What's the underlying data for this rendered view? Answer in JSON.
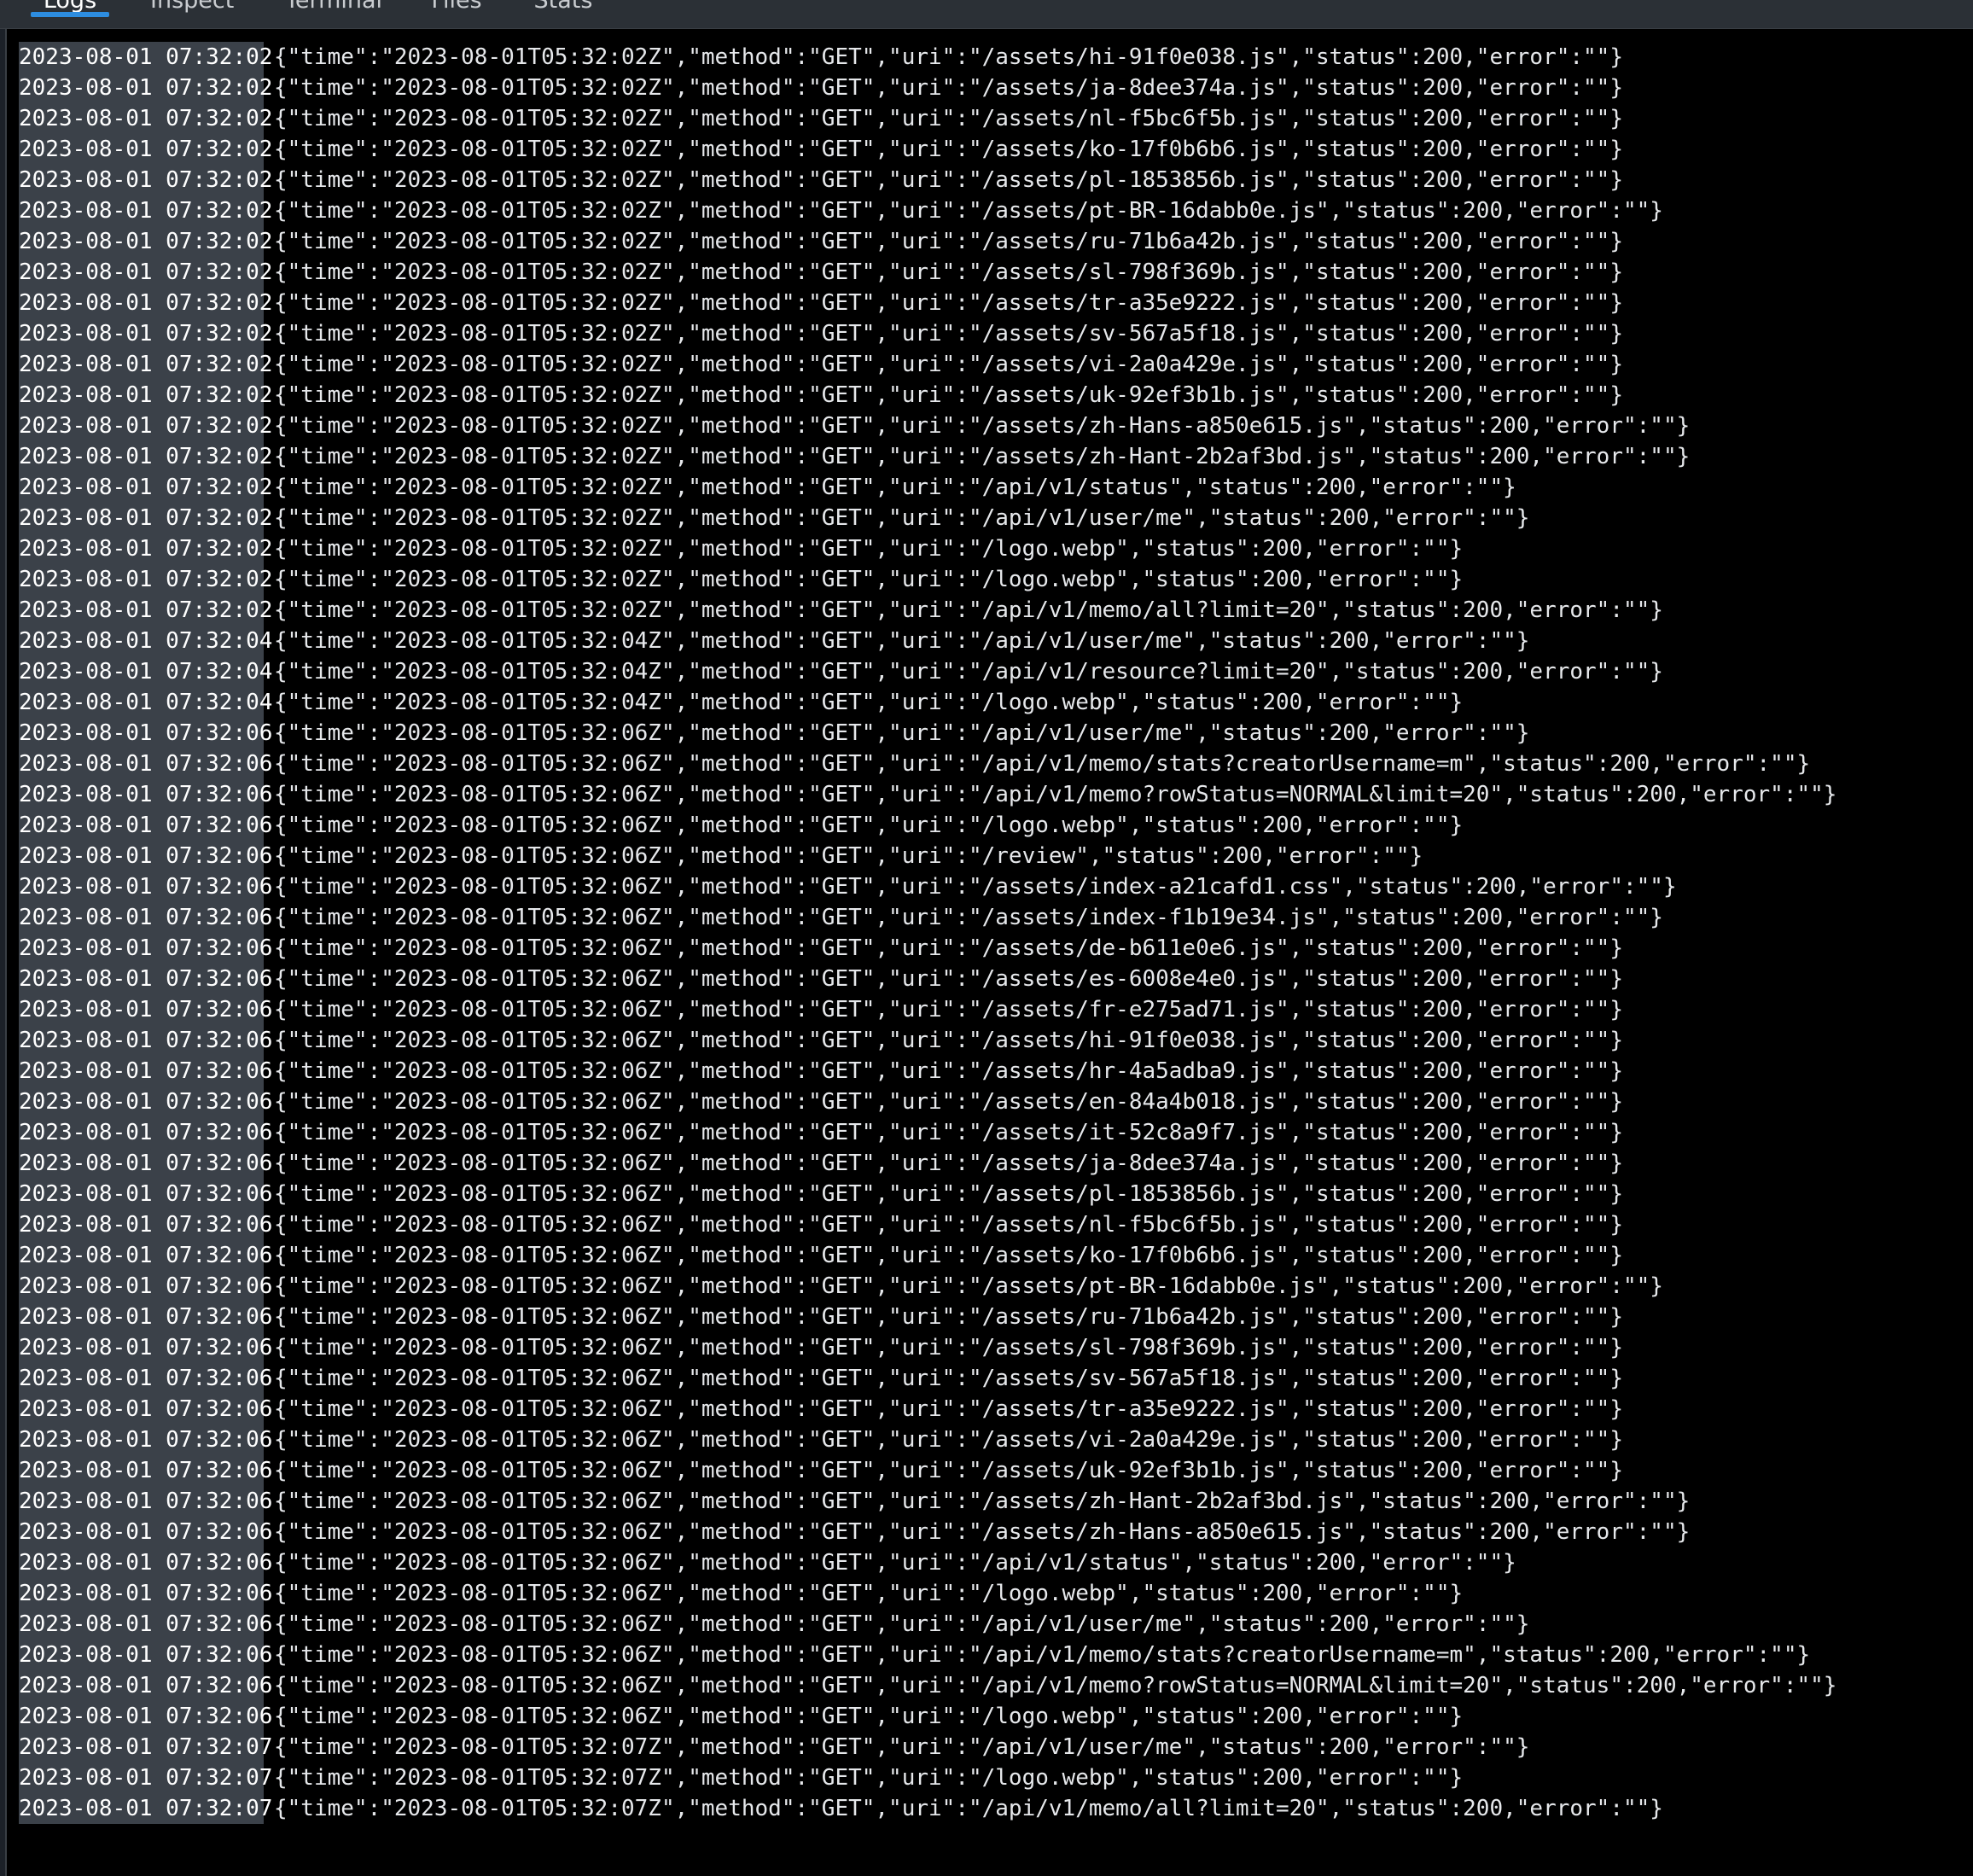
{
  "tabs": [
    {
      "label": "Logs",
      "active": true
    },
    {
      "label": "Inspect",
      "active": false
    },
    {
      "label": "Terminal",
      "active": false
    },
    {
      "label": "Files",
      "active": false
    },
    {
      "label": "Stats",
      "active": false
    }
  ],
  "colors": {
    "accent": "#2d8de0",
    "console_bg": "#000000",
    "timestamp_bg": "#3b4149"
  },
  "logs": [
    {
      "ts": "2023-08-01 07:32:02",
      "msg": "{\"time\":\"2023-08-01T05:32:02Z\",\"method\":\"GET\",\"uri\":\"/assets/hi-91f0e038.js\",\"status\":200,\"error\":\"\"}"
    },
    {
      "ts": "2023-08-01 07:32:02",
      "msg": "{\"time\":\"2023-08-01T05:32:02Z\",\"method\":\"GET\",\"uri\":\"/assets/ja-8dee374a.js\",\"status\":200,\"error\":\"\"}"
    },
    {
      "ts": "2023-08-01 07:32:02",
      "msg": "{\"time\":\"2023-08-01T05:32:02Z\",\"method\":\"GET\",\"uri\":\"/assets/nl-f5bc6f5b.js\",\"status\":200,\"error\":\"\"}"
    },
    {
      "ts": "2023-08-01 07:32:02",
      "msg": "{\"time\":\"2023-08-01T05:32:02Z\",\"method\":\"GET\",\"uri\":\"/assets/ko-17f0b6b6.js\",\"status\":200,\"error\":\"\"}"
    },
    {
      "ts": "2023-08-01 07:32:02",
      "msg": "{\"time\":\"2023-08-01T05:32:02Z\",\"method\":\"GET\",\"uri\":\"/assets/pl-1853856b.js\",\"status\":200,\"error\":\"\"}"
    },
    {
      "ts": "2023-08-01 07:32:02",
      "msg": "{\"time\":\"2023-08-01T05:32:02Z\",\"method\":\"GET\",\"uri\":\"/assets/pt-BR-16dabb0e.js\",\"status\":200,\"error\":\"\"}"
    },
    {
      "ts": "2023-08-01 07:32:02",
      "msg": "{\"time\":\"2023-08-01T05:32:02Z\",\"method\":\"GET\",\"uri\":\"/assets/ru-71b6a42b.js\",\"status\":200,\"error\":\"\"}"
    },
    {
      "ts": "2023-08-01 07:32:02",
      "msg": "{\"time\":\"2023-08-01T05:32:02Z\",\"method\":\"GET\",\"uri\":\"/assets/sl-798f369b.js\",\"status\":200,\"error\":\"\"}"
    },
    {
      "ts": "2023-08-01 07:32:02",
      "msg": "{\"time\":\"2023-08-01T05:32:02Z\",\"method\":\"GET\",\"uri\":\"/assets/tr-a35e9222.js\",\"status\":200,\"error\":\"\"}"
    },
    {
      "ts": "2023-08-01 07:32:02",
      "msg": "{\"time\":\"2023-08-01T05:32:02Z\",\"method\":\"GET\",\"uri\":\"/assets/sv-567a5f18.js\",\"status\":200,\"error\":\"\"}"
    },
    {
      "ts": "2023-08-01 07:32:02",
      "msg": "{\"time\":\"2023-08-01T05:32:02Z\",\"method\":\"GET\",\"uri\":\"/assets/vi-2a0a429e.js\",\"status\":200,\"error\":\"\"}"
    },
    {
      "ts": "2023-08-01 07:32:02",
      "msg": "{\"time\":\"2023-08-01T05:32:02Z\",\"method\":\"GET\",\"uri\":\"/assets/uk-92ef3b1b.js\",\"status\":200,\"error\":\"\"}"
    },
    {
      "ts": "2023-08-01 07:32:02",
      "msg": "{\"time\":\"2023-08-01T05:32:02Z\",\"method\":\"GET\",\"uri\":\"/assets/zh-Hans-a850e615.js\",\"status\":200,\"error\":\"\"}"
    },
    {
      "ts": "2023-08-01 07:32:02",
      "msg": "{\"time\":\"2023-08-01T05:32:02Z\",\"method\":\"GET\",\"uri\":\"/assets/zh-Hant-2b2af3bd.js\",\"status\":200,\"error\":\"\"}"
    },
    {
      "ts": "2023-08-01 07:32:02",
      "msg": "{\"time\":\"2023-08-01T05:32:02Z\",\"method\":\"GET\",\"uri\":\"/api/v1/status\",\"status\":200,\"error\":\"\"}"
    },
    {
      "ts": "2023-08-01 07:32:02",
      "msg": "{\"time\":\"2023-08-01T05:32:02Z\",\"method\":\"GET\",\"uri\":\"/api/v1/user/me\",\"status\":200,\"error\":\"\"}"
    },
    {
      "ts": "2023-08-01 07:32:02",
      "msg": "{\"time\":\"2023-08-01T05:32:02Z\",\"method\":\"GET\",\"uri\":\"/logo.webp\",\"status\":200,\"error\":\"\"}"
    },
    {
      "ts": "2023-08-01 07:32:02",
      "msg": "{\"time\":\"2023-08-01T05:32:02Z\",\"method\":\"GET\",\"uri\":\"/logo.webp\",\"status\":200,\"error\":\"\"}"
    },
    {
      "ts": "2023-08-01 07:32:02",
      "msg": "{\"time\":\"2023-08-01T05:32:02Z\",\"method\":\"GET\",\"uri\":\"/api/v1/memo/all?limit=20\",\"status\":200,\"error\":\"\"}"
    },
    {
      "ts": "2023-08-01 07:32:04",
      "msg": "{\"time\":\"2023-08-01T05:32:04Z\",\"method\":\"GET\",\"uri\":\"/api/v1/user/me\",\"status\":200,\"error\":\"\"}"
    },
    {
      "ts": "2023-08-01 07:32:04",
      "msg": "{\"time\":\"2023-08-01T05:32:04Z\",\"method\":\"GET\",\"uri\":\"/api/v1/resource?limit=20\",\"status\":200,\"error\":\"\"}"
    },
    {
      "ts": "2023-08-01 07:32:04",
      "msg": "{\"time\":\"2023-08-01T05:32:04Z\",\"method\":\"GET\",\"uri\":\"/logo.webp\",\"status\":200,\"error\":\"\"}"
    },
    {
      "ts": "2023-08-01 07:32:06",
      "msg": "{\"time\":\"2023-08-01T05:32:06Z\",\"method\":\"GET\",\"uri\":\"/api/v1/user/me\",\"status\":200,\"error\":\"\"}"
    },
    {
      "ts": "2023-08-01 07:32:06",
      "msg": "{\"time\":\"2023-08-01T05:32:06Z\",\"method\":\"GET\",\"uri\":\"/api/v1/memo/stats?creatorUsername=m\",\"status\":200,\"error\":\"\"}"
    },
    {
      "ts": "2023-08-01 07:32:06",
      "msg": "{\"time\":\"2023-08-01T05:32:06Z\",\"method\":\"GET\",\"uri\":\"/api/v1/memo?rowStatus=NORMAL&limit=20\",\"status\":200,\"error\":\"\"}"
    },
    {
      "ts": "2023-08-01 07:32:06",
      "msg": "{\"time\":\"2023-08-01T05:32:06Z\",\"method\":\"GET\",\"uri\":\"/logo.webp\",\"status\":200,\"error\":\"\"}"
    },
    {
      "ts": "2023-08-01 07:32:06",
      "msg": "{\"time\":\"2023-08-01T05:32:06Z\",\"method\":\"GET\",\"uri\":\"/review\",\"status\":200,\"error\":\"\"}"
    },
    {
      "ts": "2023-08-01 07:32:06",
      "msg": "{\"time\":\"2023-08-01T05:32:06Z\",\"method\":\"GET\",\"uri\":\"/assets/index-a21cafd1.css\",\"status\":200,\"error\":\"\"}"
    },
    {
      "ts": "2023-08-01 07:32:06",
      "msg": "{\"time\":\"2023-08-01T05:32:06Z\",\"method\":\"GET\",\"uri\":\"/assets/index-f1b19e34.js\",\"status\":200,\"error\":\"\"}"
    },
    {
      "ts": "2023-08-01 07:32:06",
      "msg": "{\"time\":\"2023-08-01T05:32:06Z\",\"method\":\"GET\",\"uri\":\"/assets/de-b611e0e6.js\",\"status\":200,\"error\":\"\"}"
    },
    {
      "ts": "2023-08-01 07:32:06",
      "msg": "{\"time\":\"2023-08-01T05:32:06Z\",\"method\":\"GET\",\"uri\":\"/assets/es-6008e4e0.js\",\"status\":200,\"error\":\"\"}"
    },
    {
      "ts": "2023-08-01 07:32:06",
      "msg": "{\"time\":\"2023-08-01T05:32:06Z\",\"method\":\"GET\",\"uri\":\"/assets/fr-e275ad71.js\",\"status\":200,\"error\":\"\"}"
    },
    {
      "ts": "2023-08-01 07:32:06",
      "msg": "{\"time\":\"2023-08-01T05:32:06Z\",\"method\":\"GET\",\"uri\":\"/assets/hi-91f0e038.js\",\"status\":200,\"error\":\"\"}"
    },
    {
      "ts": "2023-08-01 07:32:06",
      "msg": "{\"time\":\"2023-08-01T05:32:06Z\",\"method\":\"GET\",\"uri\":\"/assets/hr-4a5adba9.js\",\"status\":200,\"error\":\"\"}"
    },
    {
      "ts": "2023-08-01 07:32:06",
      "msg": "{\"time\":\"2023-08-01T05:32:06Z\",\"method\":\"GET\",\"uri\":\"/assets/en-84a4b018.js\",\"status\":200,\"error\":\"\"}"
    },
    {
      "ts": "2023-08-01 07:32:06",
      "msg": "{\"time\":\"2023-08-01T05:32:06Z\",\"method\":\"GET\",\"uri\":\"/assets/it-52c8a9f7.js\",\"status\":200,\"error\":\"\"}"
    },
    {
      "ts": "2023-08-01 07:32:06",
      "msg": "{\"time\":\"2023-08-01T05:32:06Z\",\"method\":\"GET\",\"uri\":\"/assets/ja-8dee374a.js\",\"status\":200,\"error\":\"\"}"
    },
    {
      "ts": "2023-08-01 07:32:06",
      "msg": "{\"time\":\"2023-08-01T05:32:06Z\",\"method\":\"GET\",\"uri\":\"/assets/pl-1853856b.js\",\"status\":200,\"error\":\"\"}"
    },
    {
      "ts": "2023-08-01 07:32:06",
      "msg": "{\"time\":\"2023-08-01T05:32:06Z\",\"method\":\"GET\",\"uri\":\"/assets/nl-f5bc6f5b.js\",\"status\":200,\"error\":\"\"}"
    },
    {
      "ts": "2023-08-01 07:32:06",
      "msg": "{\"time\":\"2023-08-01T05:32:06Z\",\"method\":\"GET\",\"uri\":\"/assets/ko-17f0b6b6.js\",\"status\":200,\"error\":\"\"}"
    },
    {
      "ts": "2023-08-01 07:32:06",
      "msg": "{\"time\":\"2023-08-01T05:32:06Z\",\"method\":\"GET\",\"uri\":\"/assets/pt-BR-16dabb0e.js\",\"status\":200,\"error\":\"\"}"
    },
    {
      "ts": "2023-08-01 07:32:06",
      "msg": "{\"time\":\"2023-08-01T05:32:06Z\",\"method\":\"GET\",\"uri\":\"/assets/ru-71b6a42b.js\",\"status\":200,\"error\":\"\"}"
    },
    {
      "ts": "2023-08-01 07:32:06",
      "msg": "{\"time\":\"2023-08-01T05:32:06Z\",\"method\":\"GET\",\"uri\":\"/assets/sl-798f369b.js\",\"status\":200,\"error\":\"\"}"
    },
    {
      "ts": "2023-08-01 07:32:06",
      "msg": "{\"time\":\"2023-08-01T05:32:06Z\",\"method\":\"GET\",\"uri\":\"/assets/sv-567a5f18.js\",\"status\":200,\"error\":\"\"}"
    },
    {
      "ts": "2023-08-01 07:32:06",
      "msg": "{\"time\":\"2023-08-01T05:32:06Z\",\"method\":\"GET\",\"uri\":\"/assets/tr-a35e9222.js\",\"status\":200,\"error\":\"\"}"
    },
    {
      "ts": "2023-08-01 07:32:06",
      "msg": "{\"time\":\"2023-08-01T05:32:06Z\",\"method\":\"GET\",\"uri\":\"/assets/vi-2a0a429e.js\",\"status\":200,\"error\":\"\"}"
    },
    {
      "ts": "2023-08-01 07:32:06",
      "msg": "{\"time\":\"2023-08-01T05:32:06Z\",\"method\":\"GET\",\"uri\":\"/assets/uk-92ef3b1b.js\",\"status\":200,\"error\":\"\"}"
    },
    {
      "ts": "2023-08-01 07:32:06",
      "msg": "{\"time\":\"2023-08-01T05:32:06Z\",\"method\":\"GET\",\"uri\":\"/assets/zh-Hant-2b2af3bd.js\",\"status\":200,\"error\":\"\"}"
    },
    {
      "ts": "2023-08-01 07:32:06",
      "msg": "{\"time\":\"2023-08-01T05:32:06Z\",\"method\":\"GET\",\"uri\":\"/assets/zh-Hans-a850e615.js\",\"status\":200,\"error\":\"\"}"
    },
    {
      "ts": "2023-08-01 07:32:06",
      "msg": "{\"time\":\"2023-08-01T05:32:06Z\",\"method\":\"GET\",\"uri\":\"/api/v1/status\",\"status\":200,\"error\":\"\"}"
    },
    {
      "ts": "2023-08-01 07:32:06",
      "msg": "{\"time\":\"2023-08-01T05:32:06Z\",\"method\":\"GET\",\"uri\":\"/logo.webp\",\"status\":200,\"error\":\"\"}"
    },
    {
      "ts": "2023-08-01 07:32:06",
      "msg": "{\"time\":\"2023-08-01T05:32:06Z\",\"method\":\"GET\",\"uri\":\"/api/v1/user/me\",\"status\":200,\"error\":\"\"}"
    },
    {
      "ts": "2023-08-01 07:32:06",
      "msg": "{\"time\":\"2023-08-01T05:32:06Z\",\"method\":\"GET\",\"uri\":\"/api/v1/memo/stats?creatorUsername=m\",\"status\":200,\"error\":\"\"}"
    },
    {
      "ts": "2023-08-01 07:32:06",
      "msg": "{\"time\":\"2023-08-01T05:32:06Z\",\"method\":\"GET\",\"uri\":\"/api/v1/memo?rowStatus=NORMAL&limit=20\",\"status\":200,\"error\":\"\"}"
    },
    {
      "ts": "2023-08-01 07:32:06",
      "msg": "{\"time\":\"2023-08-01T05:32:06Z\",\"method\":\"GET\",\"uri\":\"/logo.webp\",\"status\":200,\"error\":\"\"}"
    },
    {
      "ts": "2023-08-01 07:32:07",
      "msg": "{\"time\":\"2023-08-01T05:32:07Z\",\"method\":\"GET\",\"uri\":\"/api/v1/user/me\",\"status\":200,\"error\":\"\"}"
    },
    {
      "ts": "2023-08-01 07:32:07",
      "msg": "{\"time\":\"2023-08-01T05:32:07Z\",\"method\":\"GET\",\"uri\":\"/logo.webp\",\"status\":200,\"error\":\"\"}"
    },
    {
      "ts": "2023-08-01 07:32:07",
      "msg": "{\"time\":\"2023-08-01T05:32:07Z\",\"method\":\"GET\",\"uri\":\"/api/v1/memo/all?limit=20\",\"status\":200,\"error\":\"\"}"
    }
  ]
}
